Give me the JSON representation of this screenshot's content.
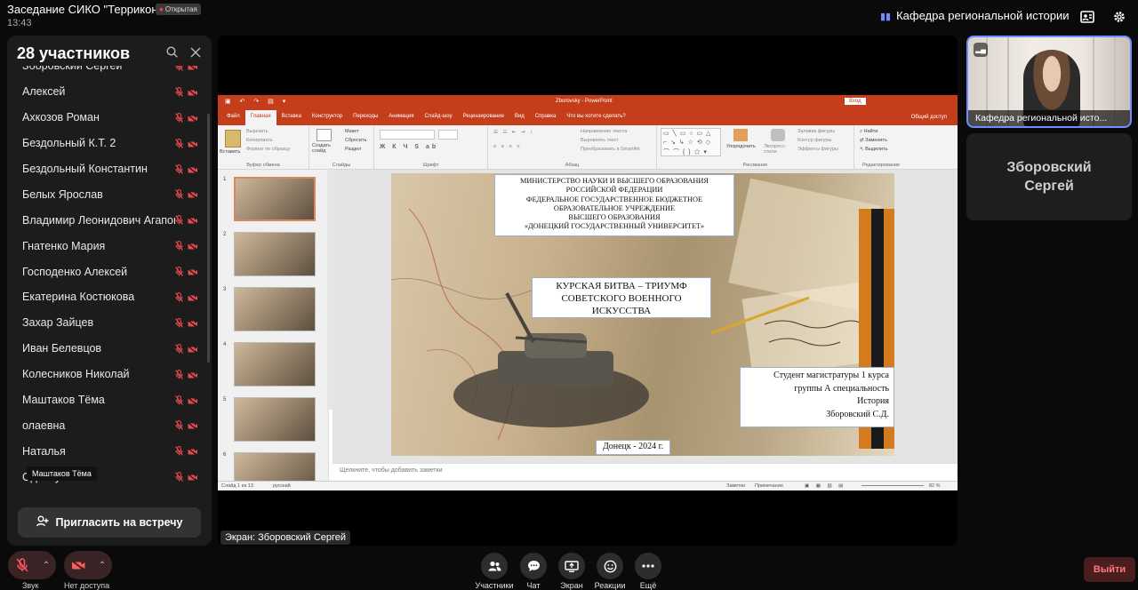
{
  "meeting": {
    "title": "Заседание СИКО \"Террикон\"",
    "badge": "Открытая",
    "time": "13:43",
    "room": "Кафедра региональной истории",
    "accent": "#6d8cff",
    "danger": "#e5484d"
  },
  "participants": {
    "count_label": "28 участников",
    "items": [
      {
        "name": "Зборовский Сергей"
      },
      {
        "name": "Алексей"
      },
      {
        "name": "Ахкозов Роман"
      },
      {
        "name": "Бездольный К.Т. 2"
      },
      {
        "name": "Бездольный Константин"
      },
      {
        "name": "Белых Ярослав"
      },
      {
        "name": "Владимир Леонидович Агапов"
      },
      {
        "name": "Гнатенко Мария"
      },
      {
        "name": "Господенко Алексей"
      },
      {
        "name": "Екатерина Костюкова"
      },
      {
        "name": "Захар Зайцев"
      },
      {
        "name": "Иван Белевцов"
      },
      {
        "name": "Колесников Николай"
      },
      {
        "name": "Маштаков Тёма"
      },
      {
        "name": "олаевна"
      },
      {
        "name": "Наталья"
      },
      {
        "name": "Односум Геля"
      }
    ],
    "tooltip": "Маштаков Тёма",
    "invite_label": "Пригласить на встречу"
  },
  "screen": {
    "label": "Экран: Зборовский Сергей",
    "ppt": {
      "doc_title": "Zborovsky  -  PowerPoint",
      "login": "Вход",
      "tabs": [
        "Файл",
        "Главная",
        "Вставка",
        "Конструктор",
        "Переходы",
        "Анимация",
        "Слайд-шоу",
        "Рецензирование",
        "Вид",
        "Справка",
        "Что вы хотите сделать?"
      ],
      "share": "Общий доступ",
      "groups": [
        "Буфер обмена",
        "Слайды",
        "Шрифт",
        "Абзац",
        "Рисование",
        "Редактирование"
      ],
      "ribbon_items": {
        "paste": "Вставить",
        "cut": "Вырезать",
        "copy": "Копировать",
        "format": "Формат по образцу",
        "new_slide": "Создать слайд",
        "layout": "Макет",
        "reset": "Сбросить",
        "section": "Раздел",
        "text_dir": "Направление текста",
        "align_text": "Выровнять текст",
        "smartart": "Преобразовать в SmartArt",
        "arrange": "Упорядочить",
        "express": "Экспресс-стили",
        "fill": "Заливка фигуры",
        "outline": "Контур фигуры",
        "effects": "Эффекты фигуры",
        "find": "Найти",
        "replace": "Заменить",
        "select": "Выделить"
      },
      "slide_count": [
        "1",
        "2",
        "3",
        "4",
        "5",
        "6"
      ],
      "slide": {
        "header_lines": [
          "МИНИСТЕРСТВО НАУКИ И ВЫСШЕГО ОБРАЗОВАНИЯ",
          "РОССИЙСКОЙ ФЕДЕРАЦИИ",
          "ФЕДЕРАЛЬНОЕ ГОСУДАРСТВЕННОЕ БЮДЖЕТНОЕ",
          "ОБРАЗОВАТЕЛЬНОЕ УЧРЕЖДЕНИЕ",
          "ВЫСШЕГО ОБРАЗОВАНИЯ",
          "«ДОНЕЦКИЙ ГОСУДАРСТВЕННЫЙ УНИВЕРСИТЕТ»"
        ],
        "title_lines": [
          "КУРСКАЯ БИТВА – ТРИУМФ",
          "СОВЕТСКОГО  ВОЕННОГО",
          "ИСКУССТВА"
        ],
        "author_lines": [
          "Студент  магистратуры 1 курса",
          "группы А специальность",
          "История",
          "Зборовский С.Д."
        ],
        "footer": "Донецк - 2024 г."
      },
      "notes_placeholder": "Щелкните, чтобы добавить заметки",
      "status": {
        "slide_of": "Слайд 1 из 13",
        "lang": "русский",
        "notes": "Заметки",
        "comments": "Примечания",
        "zoom": "82 %"
      }
    }
  },
  "self_view": {
    "label": "Кафедра региональной исто..."
  },
  "remote_tile": {
    "name": "Зборовский Сергей"
  },
  "controls": {
    "mic_label": "Звук",
    "cam_label": "Нет доступа",
    "participants": "Участники",
    "chat": "Чат",
    "screen": "Экран",
    "reactions": "Реакции",
    "more": "Ещё",
    "exit": "Выйти"
  }
}
